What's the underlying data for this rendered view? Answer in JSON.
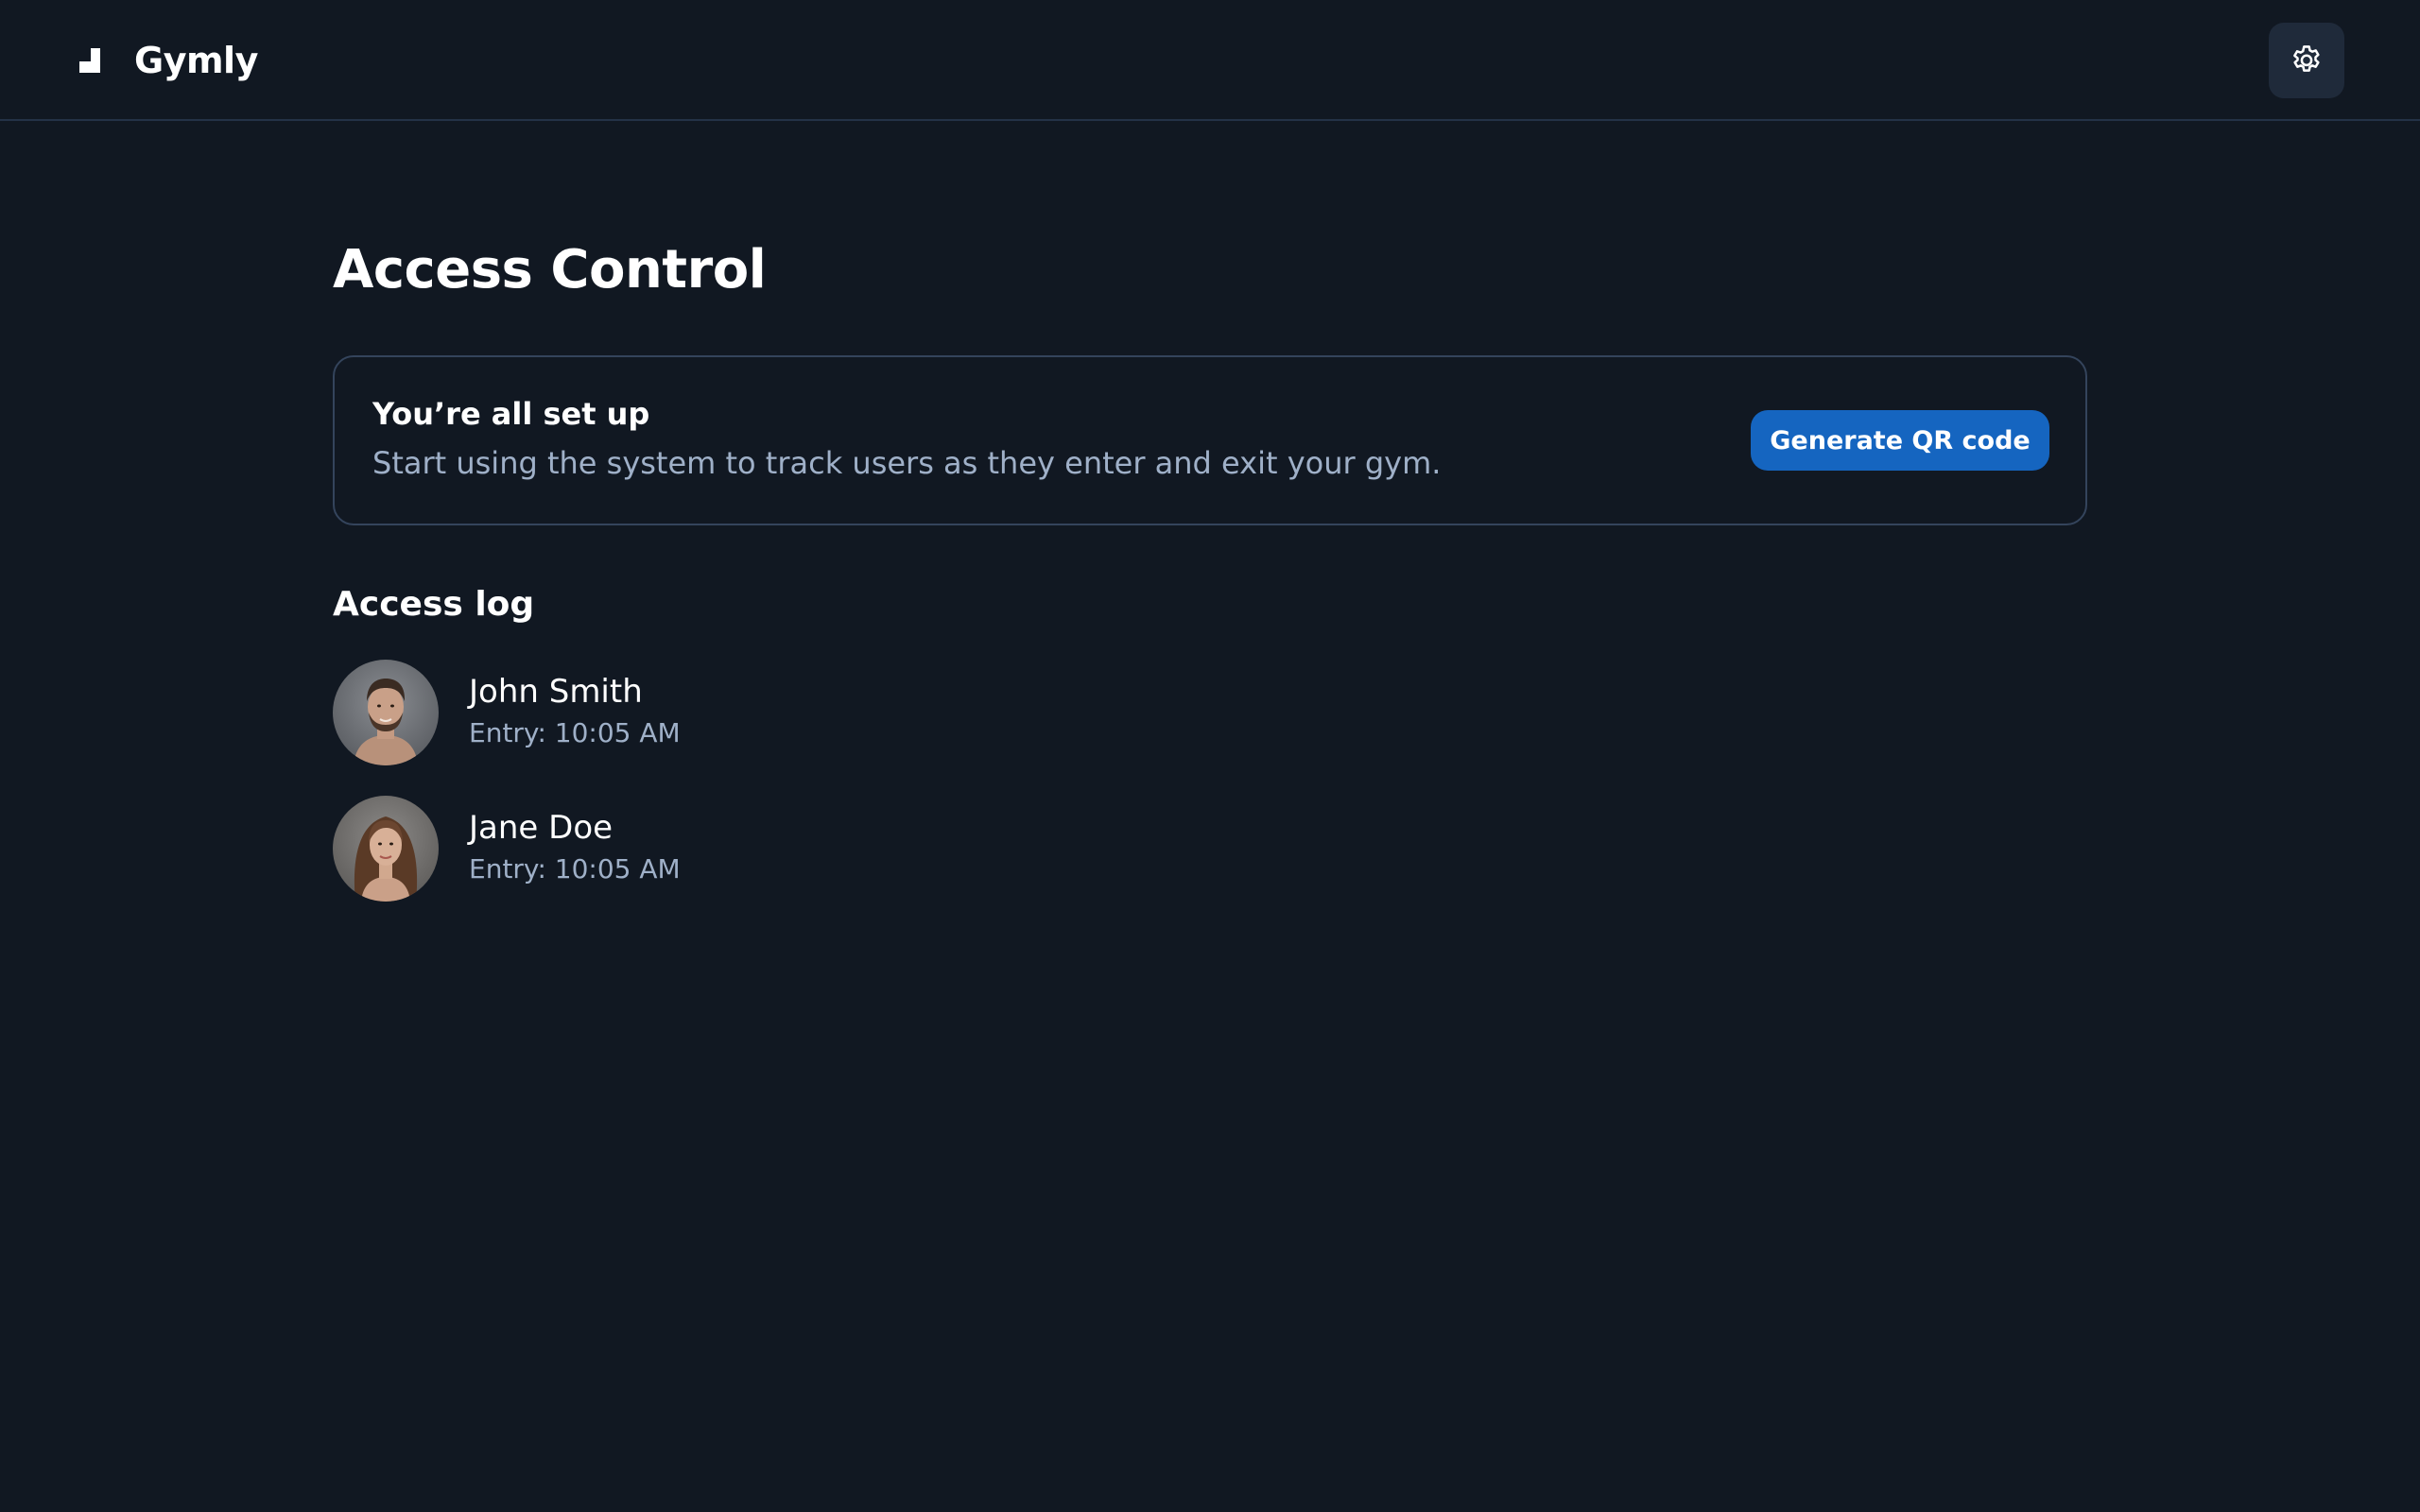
{
  "header": {
    "brand_name": "Gymly",
    "logo_icon": "stairs-logo-icon",
    "settings_icon": "gear-icon"
  },
  "main": {
    "title": "Access Control",
    "status_card": {
      "title": "You’re all set up",
      "description": "Start using the system to track users as they enter and exit your gym.",
      "button_label": "Generate QR code"
    },
    "access_log": {
      "title": "Access log",
      "entries": [
        {
          "name": "John Smith",
          "time": "Entry: 10:05 AM",
          "avatar": "man-portrait"
        },
        {
          "name": "Jane Doe",
          "time": "Entry: 10:05 AM",
          "avatar": "woman-portrait"
        }
      ]
    }
  },
  "colors": {
    "background": "#111822",
    "card_border": "#34445c",
    "muted_text": "#9fb0c8",
    "accent": "#1565c0",
    "settings_button_bg": "#1f2a3a"
  }
}
